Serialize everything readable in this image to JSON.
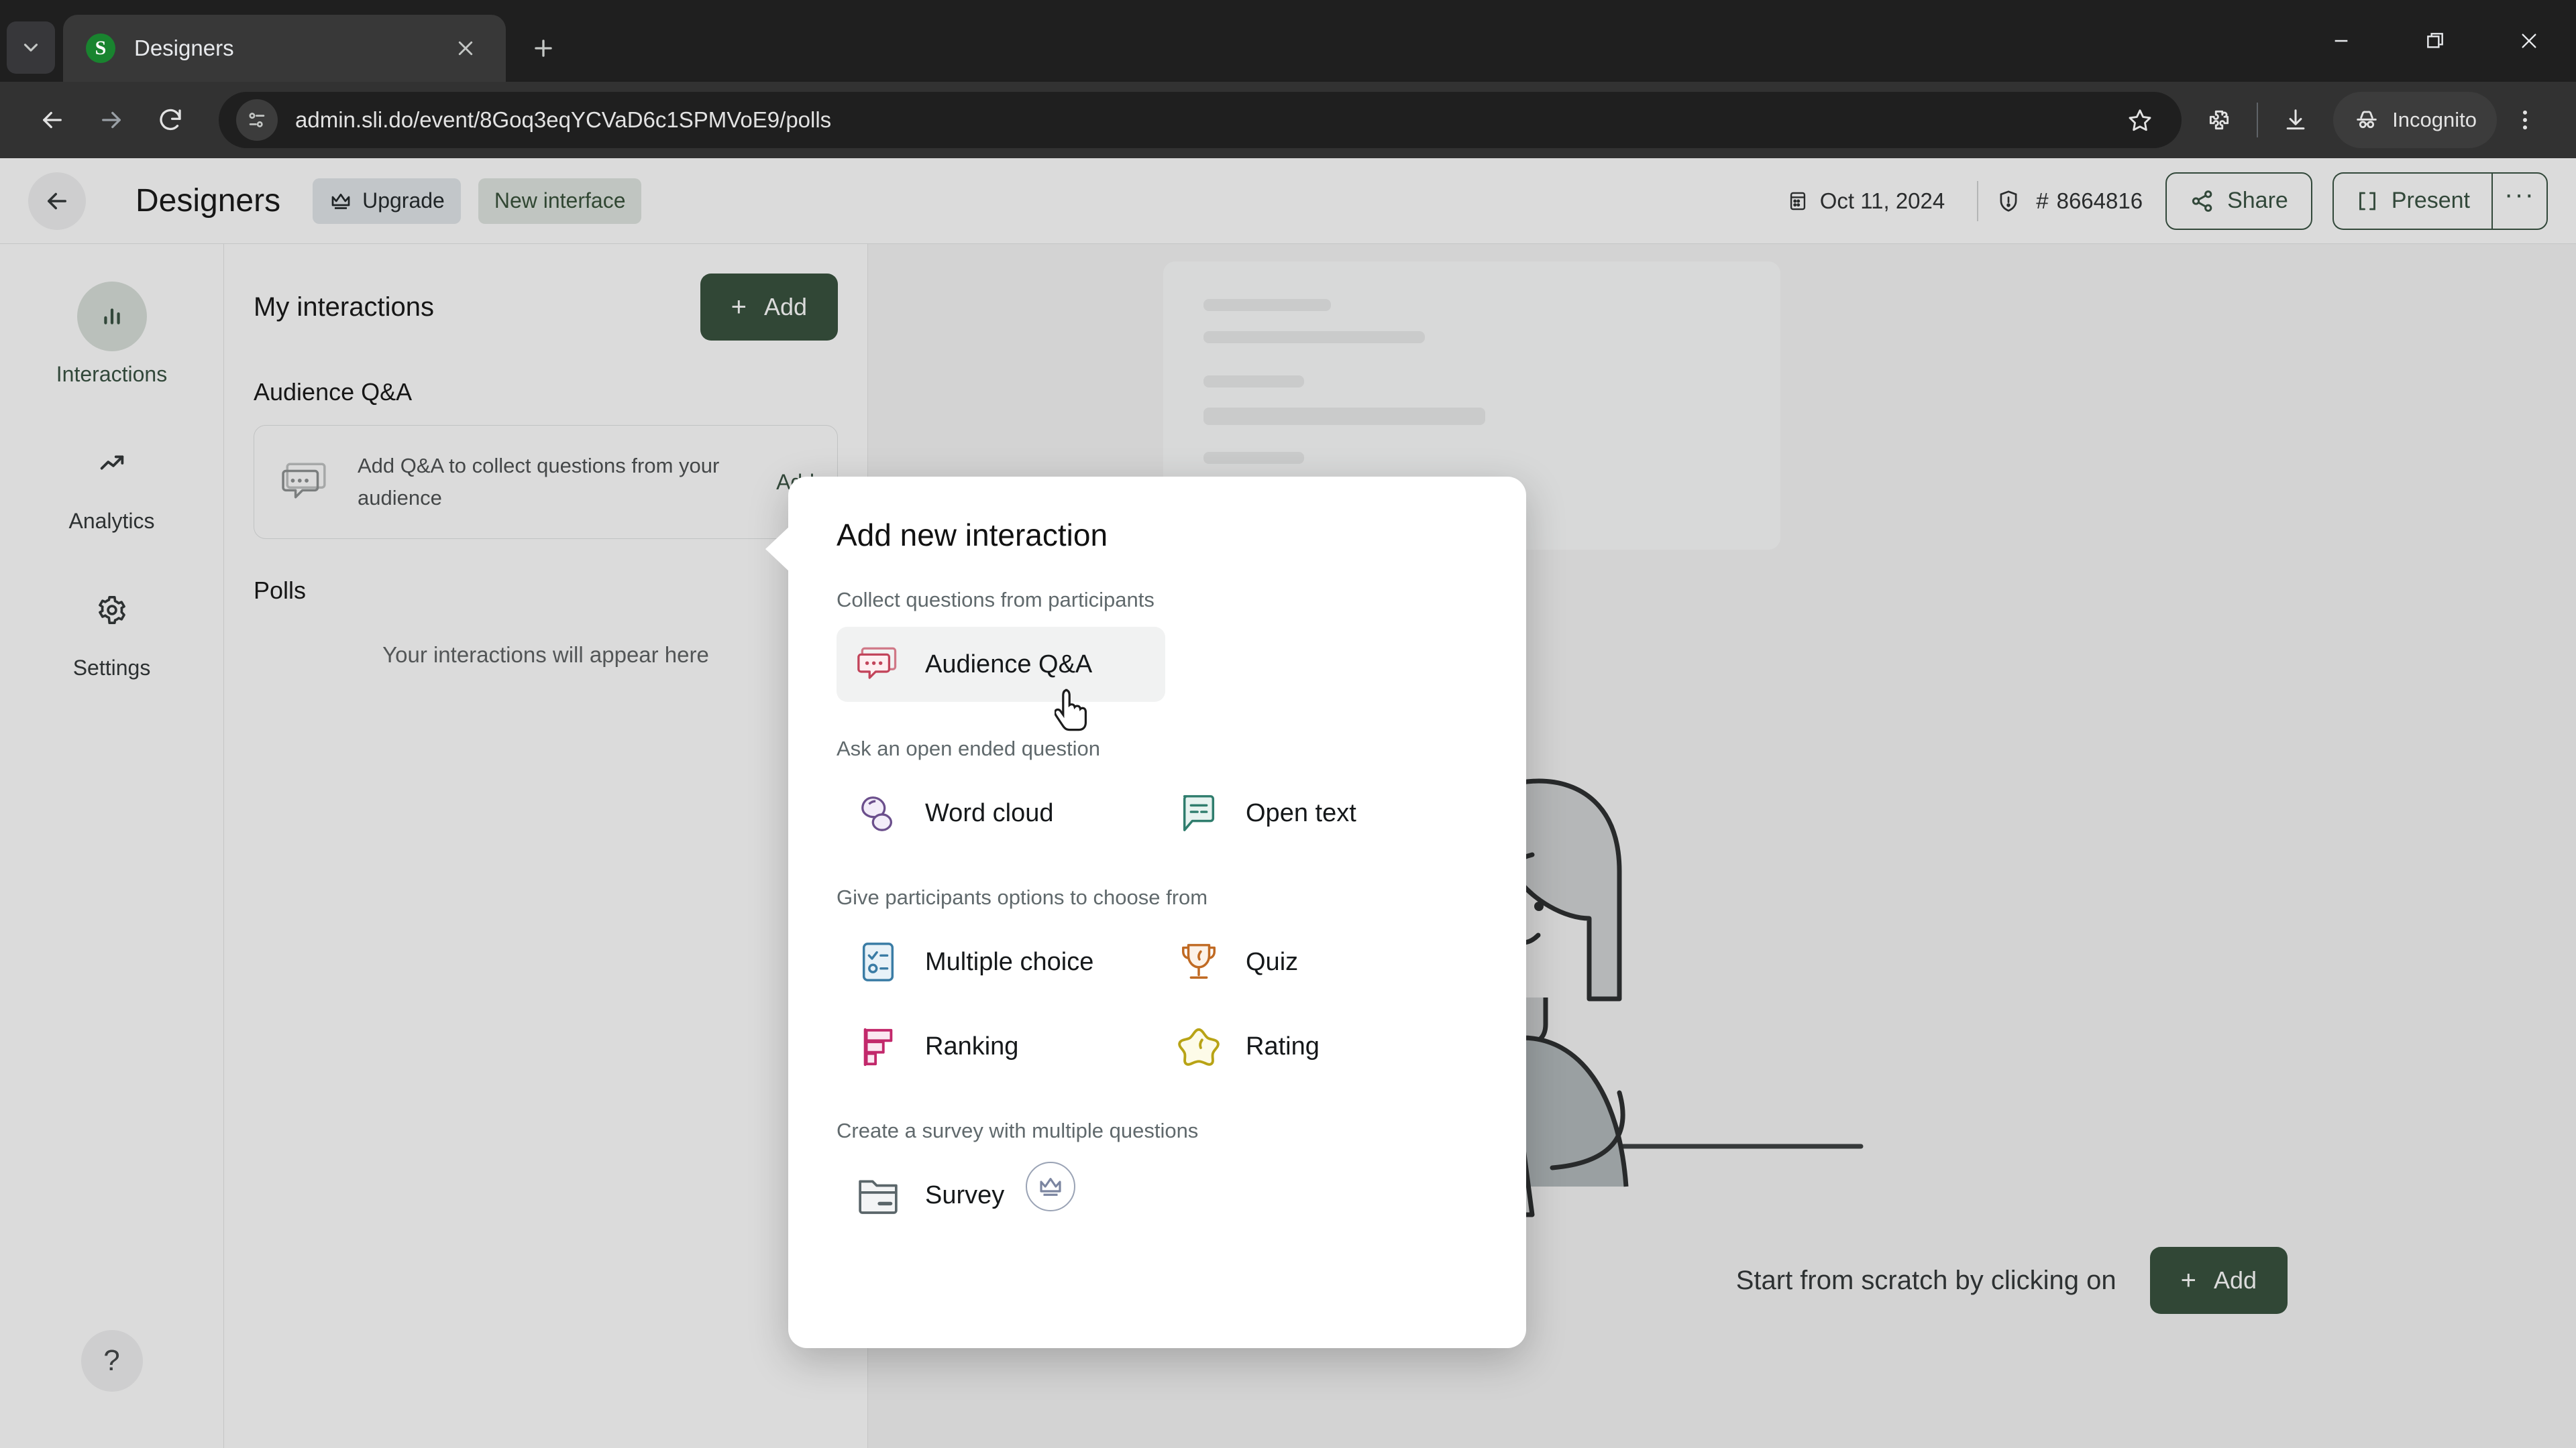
{
  "browser": {
    "tab": {
      "title": "Designers",
      "favicon_letter": "S",
      "favicon_color": "#19842f"
    },
    "new_tab_label": "+",
    "url": "admin.sli.do/event/8Goq3eqYCVaD6c1SPMVoE9/polls",
    "profile_label": "Incognito",
    "icons": {
      "tab_list": "chevron-down-icon",
      "tab_close": "close-icon",
      "back": "back-arrow-icon",
      "forward": "forward-arrow-icon",
      "reload": "reload-icon",
      "site_info": "page-settings-icon",
      "bookmark": "star-icon",
      "extensions": "extensions-icon",
      "downloads": "download-icon",
      "incognito": "incognito-hat-icon",
      "menu": "three-dot-menu-icon",
      "minimize": "minimize-icon",
      "maximize": "restore-icon",
      "close": "window-close-icon"
    }
  },
  "app": {
    "header": {
      "back_icon": "back-arrow-icon",
      "title": "Designers",
      "upgrade_label": "Upgrade",
      "upgrade_icon": "crown-icon",
      "new_interface_label": "New interface",
      "date": "Oct 11, 2024",
      "date_icon": "calendar-icon",
      "warning_icon": "shield-alert-icon",
      "event_code_prefix": "#",
      "event_code": "8664816",
      "share_label": "Share",
      "share_icon": "share-nodes-icon",
      "present_label": "Present",
      "present_icon": "fullscreen-brackets-icon",
      "more_label": "···"
    },
    "rail": {
      "items": [
        {
          "label": "Interactions",
          "icon": "bar-chart-icon",
          "active": true
        },
        {
          "label": "Analytics",
          "icon": "trending-up-icon",
          "active": false
        },
        {
          "label": "Settings",
          "icon": "gear-icon",
          "active": false
        }
      ],
      "help_label": "?"
    },
    "list_pane": {
      "heading": "My interactions",
      "add_label": "Add",
      "add_plus": "+",
      "qa_section_title": "Audience Q&A",
      "qa_card": {
        "icon": "speech-bubble-dots-icon",
        "text": "Add Q&A to collect questions from your audience",
        "action_label": "Add"
      },
      "polls_section_title": "Polls",
      "empty_text": "Your interactions will appear here"
    },
    "canvas": {
      "scratch_text": "Start from scratch by clicking on",
      "scratch_add_label": "Add",
      "scratch_add_plus": "+",
      "illustration": "person-at-laptop-illustration"
    }
  },
  "popover": {
    "title": "Add new interaction",
    "groups": [
      {
        "label": "Collect questions from participants",
        "options": [
          {
            "label": "Audience Q&A",
            "icon": "speech-bubble-dots-icon",
            "color": "#c2445a",
            "hovered": true
          }
        ]
      },
      {
        "label": "Ask an open ended question",
        "options": [
          {
            "label": "Word cloud",
            "icon": "cloud-icon",
            "color": "#6b4f8c",
            "hovered": false
          },
          {
            "label": "Open text",
            "icon": "text-bubble-icon",
            "color": "#2f7d6d",
            "hovered": false
          }
        ]
      },
      {
        "label": "Give participants options to choose from",
        "options": [
          {
            "label": "Multiple choice",
            "icon": "checklist-icon",
            "color": "#3a7ca5",
            "hovered": false
          },
          {
            "label": "Quiz",
            "icon": "trophy-icon",
            "color": "#c06a23",
            "hovered": false
          },
          {
            "label": "Ranking",
            "icon": "ranking-bars-icon",
            "color": "#c2286b",
            "hovered": false
          },
          {
            "label": "Rating",
            "icon": "star-outline-icon",
            "color": "#b8a315",
            "hovered": false
          }
        ]
      },
      {
        "label": "Create a survey with multiple questions",
        "options": [
          {
            "label": "Survey",
            "icon": "folder-icon",
            "color": "#5a6569",
            "hovered": false
          }
        ],
        "premium_badge": "crown-icon"
      }
    ]
  },
  "colors": {
    "brand_green": "#1b5e2a",
    "accent_green": "#1b5e34",
    "page_bg": "#f4f6f6",
    "chrome_dark": "#1f1f1f",
    "toolbar_dark": "#323232"
  }
}
